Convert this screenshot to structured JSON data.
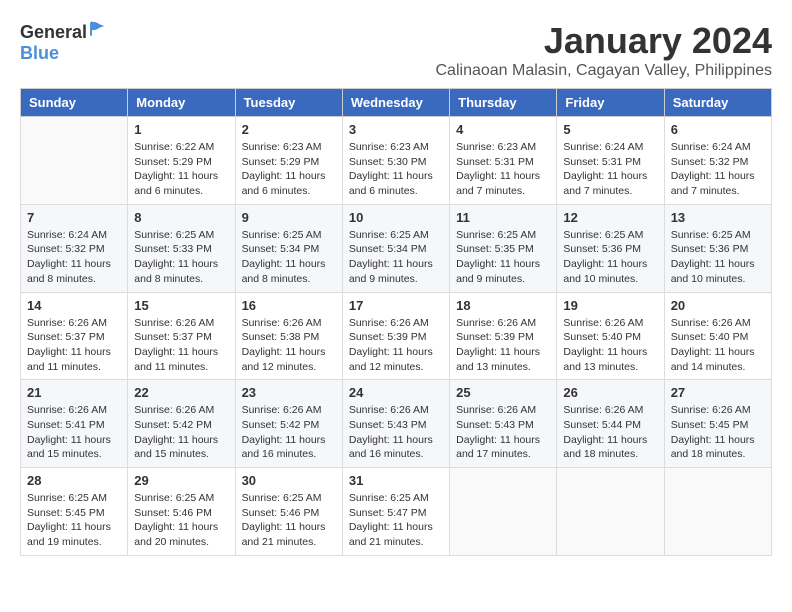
{
  "header": {
    "logo_general": "General",
    "logo_blue": "Blue",
    "month_title": "January 2024",
    "subtitle": "Calinaoan Malasin, Cagayan Valley, Philippines"
  },
  "days_of_week": [
    "Sunday",
    "Monday",
    "Tuesday",
    "Wednesday",
    "Thursday",
    "Friday",
    "Saturday"
  ],
  "weeks": [
    [
      {
        "day": "",
        "text": ""
      },
      {
        "day": "1",
        "text": "Sunrise: 6:22 AM\nSunset: 5:29 PM\nDaylight: 11 hours and 6 minutes."
      },
      {
        "day": "2",
        "text": "Sunrise: 6:23 AM\nSunset: 5:29 PM\nDaylight: 11 hours and 6 minutes."
      },
      {
        "day": "3",
        "text": "Sunrise: 6:23 AM\nSunset: 5:30 PM\nDaylight: 11 hours and 6 minutes."
      },
      {
        "day": "4",
        "text": "Sunrise: 6:23 AM\nSunset: 5:31 PM\nDaylight: 11 hours and 7 minutes."
      },
      {
        "day": "5",
        "text": "Sunrise: 6:24 AM\nSunset: 5:31 PM\nDaylight: 11 hours and 7 minutes."
      },
      {
        "day": "6",
        "text": "Sunrise: 6:24 AM\nSunset: 5:32 PM\nDaylight: 11 hours and 7 minutes."
      }
    ],
    [
      {
        "day": "7",
        "text": "Sunrise: 6:24 AM\nSunset: 5:32 PM\nDaylight: 11 hours and 8 minutes."
      },
      {
        "day": "8",
        "text": "Sunrise: 6:25 AM\nSunset: 5:33 PM\nDaylight: 11 hours and 8 minutes."
      },
      {
        "day": "9",
        "text": "Sunrise: 6:25 AM\nSunset: 5:34 PM\nDaylight: 11 hours and 8 minutes."
      },
      {
        "day": "10",
        "text": "Sunrise: 6:25 AM\nSunset: 5:34 PM\nDaylight: 11 hours and 9 minutes."
      },
      {
        "day": "11",
        "text": "Sunrise: 6:25 AM\nSunset: 5:35 PM\nDaylight: 11 hours and 9 minutes."
      },
      {
        "day": "12",
        "text": "Sunrise: 6:25 AM\nSunset: 5:36 PM\nDaylight: 11 hours and 10 minutes."
      },
      {
        "day": "13",
        "text": "Sunrise: 6:25 AM\nSunset: 5:36 PM\nDaylight: 11 hours and 10 minutes."
      }
    ],
    [
      {
        "day": "14",
        "text": "Sunrise: 6:26 AM\nSunset: 5:37 PM\nDaylight: 11 hours and 11 minutes."
      },
      {
        "day": "15",
        "text": "Sunrise: 6:26 AM\nSunset: 5:37 PM\nDaylight: 11 hours and 11 minutes."
      },
      {
        "day": "16",
        "text": "Sunrise: 6:26 AM\nSunset: 5:38 PM\nDaylight: 11 hours and 12 minutes."
      },
      {
        "day": "17",
        "text": "Sunrise: 6:26 AM\nSunset: 5:39 PM\nDaylight: 11 hours and 12 minutes."
      },
      {
        "day": "18",
        "text": "Sunrise: 6:26 AM\nSunset: 5:39 PM\nDaylight: 11 hours and 13 minutes."
      },
      {
        "day": "19",
        "text": "Sunrise: 6:26 AM\nSunset: 5:40 PM\nDaylight: 11 hours and 13 minutes."
      },
      {
        "day": "20",
        "text": "Sunrise: 6:26 AM\nSunset: 5:40 PM\nDaylight: 11 hours and 14 minutes."
      }
    ],
    [
      {
        "day": "21",
        "text": "Sunrise: 6:26 AM\nSunset: 5:41 PM\nDaylight: 11 hours and 15 minutes."
      },
      {
        "day": "22",
        "text": "Sunrise: 6:26 AM\nSunset: 5:42 PM\nDaylight: 11 hours and 15 minutes."
      },
      {
        "day": "23",
        "text": "Sunrise: 6:26 AM\nSunset: 5:42 PM\nDaylight: 11 hours and 16 minutes."
      },
      {
        "day": "24",
        "text": "Sunrise: 6:26 AM\nSunset: 5:43 PM\nDaylight: 11 hours and 16 minutes."
      },
      {
        "day": "25",
        "text": "Sunrise: 6:26 AM\nSunset: 5:43 PM\nDaylight: 11 hours and 17 minutes."
      },
      {
        "day": "26",
        "text": "Sunrise: 6:26 AM\nSunset: 5:44 PM\nDaylight: 11 hours and 18 minutes."
      },
      {
        "day": "27",
        "text": "Sunrise: 6:26 AM\nSunset: 5:45 PM\nDaylight: 11 hours and 18 minutes."
      }
    ],
    [
      {
        "day": "28",
        "text": "Sunrise: 6:25 AM\nSunset: 5:45 PM\nDaylight: 11 hours and 19 minutes."
      },
      {
        "day": "29",
        "text": "Sunrise: 6:25 AM\nSunset: 5:46 PM\nDaylight: 11 hours and 20 minutes."
      },
      {
        "day": "30",
        "text": "Sunrise: 6:25 AM\nSunset: 5:46 PM\nDaylight: 11 hours and 21 minutes."
      },
      {
        "day": "31",
        "text": "Sunrise: 6:25 AM\nSunset: 5:47 PM\nDaylight: 11 hours and 21 minutes."
      },
      {
        "day": "",
        "text": ""
      },
      {
        "day": "",
        "text": ""
      },
      {
        "day": "",
        "text": ""
      }
    ]
  ]
}
